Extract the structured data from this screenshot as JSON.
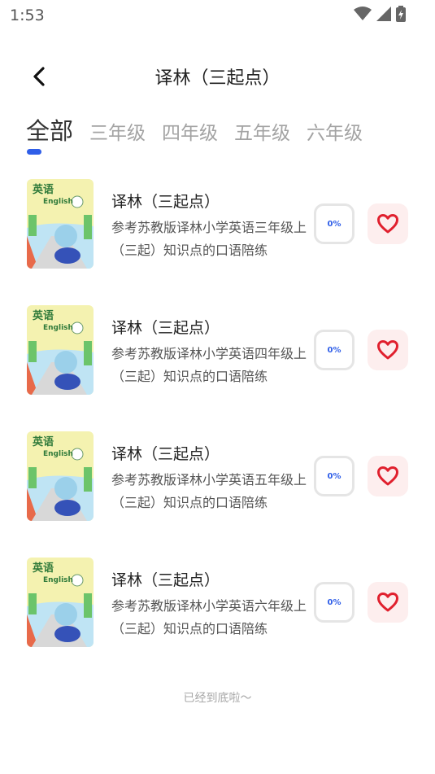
{
  "status_bar": {
    "time": "1:53"
  },
  "header": {
    "title": "译林（三起点）"
  },
  "tabs": [
    {
      "label": "全部",
      "active": true
    },
    {
      "label": "三年级",
      "active": false
    },
    {
      "label": "四年级",
      "active": false
    },
    {
      "label": "五年级",
      "active": false
    },
    {
      "label": "六年级",
      "active": false
    }
  ],
  "colors": {
    "accent": "#2f5ee8",
    "heart": "#e0202e",
    "heart_bg": "#fdeeee"
  },
  "items": [
    {
      "title": "译林（三起点）",
      "desc": "参考苏教版译林小学英语三年级上（三起）知识点的口语陪练",
      "progress": "0%",
      "cover_title": "英语",
      "cover_sub": "English"
    },
    {
      "title": "译林（三起点）",
      "desc": "参考苏教版译林小学英语四年级上（三起）知识点的口语陪练",
      "progress": "0%",
      "cover_title": "英语",
      "cover_sub": "English"
    },
    {
      "title": "译林（三起点）",
      "desc": "参考苏教版译林小学英语五年级上（三起）知识点的口语陪练",
      "progress": "0%",
      "cover_title": "英语",
      "cover_sub": "English"
    },
    {
      "title": "译林（三起点）",
      "desc": "参考苏教版译林小学英语六年级上（三起）知识点的口语陪练",
      "progress": "0%",
      "cover_title": "英语",
      "cover_sub": "English"
    }
  ],
  "footer": {
    "end_text": "已经到底啦〜"
  }
}
